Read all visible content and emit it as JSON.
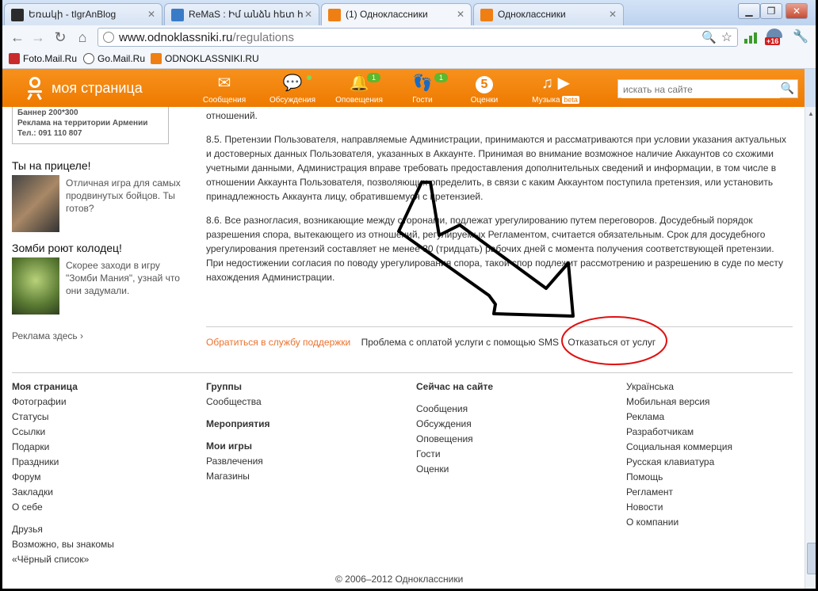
{
  "browser": {
    "tabs": [
      {
        "label": "Եռակի - tIgrAnBlog",
        "color": "#222222"
      },
      {
        "label": "ReMaS : Իմ անձն հետ հ",
        "color": "#2f6db5"
      },
      {
        "label": "(1) Одноклассники",
        "color": "#ef7f13"
      },
      {
        "label": "Одноклассники",
        "color": "#ef7f13"
      }
    ],
    "url_host": "www.odnoklassniki.ru",
    "url_path": "/regulations",
    "bookmarks": [
      "Foto.Mail.Ru",
      "Go.Mail.Ru",
      "ODNOKLASSNIKI.RU"
    ],
    "ext_badge": "+16"
  },
  "site": {
    "logo": "моя страница",
    "nav": [
      {
        "label": "Сообщения",
        "icon": "envelope-icon"
      },
      {
        "label": "Обсуждения",
        "icon": "chat-icon"
      },
      {
        "label": "Оповещения",
        "icon": "bell-icon",
        "badge": "1"
      },
      {
        "label": "Гости",
        "icon": "footprints-icon",
        "badge": "1"
      },
      {
        "label": "Оценки",
        "icon": "five-icon"
      },
      {
        "label": "Музыка",
        "icon": "music-icon",
        "extra": "beta"
      }
    ],
    "search_placeholder": "искать на сайте"
  },
  "left": {
    "banner": [
      "Баннер 200*300",
      "Реклама на территории Армении",
      "Тел.: 091 110 807"
    ],
    "promo1_title": "Ты на прицеле!",
    "promo1_text": "Отличная игра для самых продвинутых бойцов. Ты готов?",
    "promo2_title": "Зомби роют колодец!",
    "promo2_text": "Скорее заходи в игру \"Зомби Мания\", узнай что они задумали.",
    "ads_link": "Реклама здесь ›"
  },
  "main": {
    "p0": "отношений.",
    "p1": "8.5. Претензии Пользователя, направляемые Администрации, принимаются и рассматриваются при условии указания актуальных и достоверных данных Пользователя, указанных в Аккаунте. Принимая во внимание возможное наличие Аккаунтов со схожими учетными данными, Администрация вправе требовать предоставления дополнительных сведений и информации, в том числе в отношении Аккаунта Пользователя, позволяющих определить, в связи с каким Аккаунтом поступила претензия, или установить принадлежность Аккаунта лицу, обратившемуся с претензией.",
    "p2": "8.6. Все разногласия, возникающие между сторонами, подлежат урегулированию путем переговоров. Досудебный порядок разрешения спора, вытекающего из отношений, регулируемых Регламентом, считается обязательным. Срок для досудебного урегулирования претензий составляет не менее 30 (тридцать) рабочих дней с момента получения соответствующей претензии. При недостижении согласия по поводу урегулирования спора, такой спор подлежит рассмотрению и разрешению в суде по месту нахождения Администрации.",
    "link_support": "Обратиться в службу поддержки",
    "link_sms": "Проблема с оплатой услуги с помощью SMS",
    "link_cancel": "Отказаться от услуг"
  },
  "footer": {
    "col1_title": "Моя страница",
    "col1": [
      "Фотографии",
      "Статусы",
      "Ссылки",
      "Подарки",
      "Праздники",
      "Форум",
      "Закладки",
      "О себе"
    ],
    "col1b": [
      "Друзья",
      "Возможно, вы знакомы",
      "«Чёрный список»"
    ],
    "col2_groups_title": "Группы",
    "col2_groups": [
      "Сообщества"
    ],
    "col2_events_title": "Мероприятия",
    "col2_games_title": "Мои игры",
    "col2_games": [
      "Развлечения",
      "Магазины"
    ],
    "col3_title": "Сейчас на сайте",
    "col3": [
      "Сообщения",
      "Обсуждения",
      "Оповещения",
      "Гости",
      "Оценки"
    ],
    "col4": [
      "Українська",
      "Мобильная версия",
      "Реклама",
      "Разработчикам",
      "Социальная коммерция",
      "Русская клавиатура",
      "Помощь",
      "Регламент",
      "Новости",
      "О компании"
    ],
    "copyright": "© 2006–2012 Одноклассники"
  }
}
